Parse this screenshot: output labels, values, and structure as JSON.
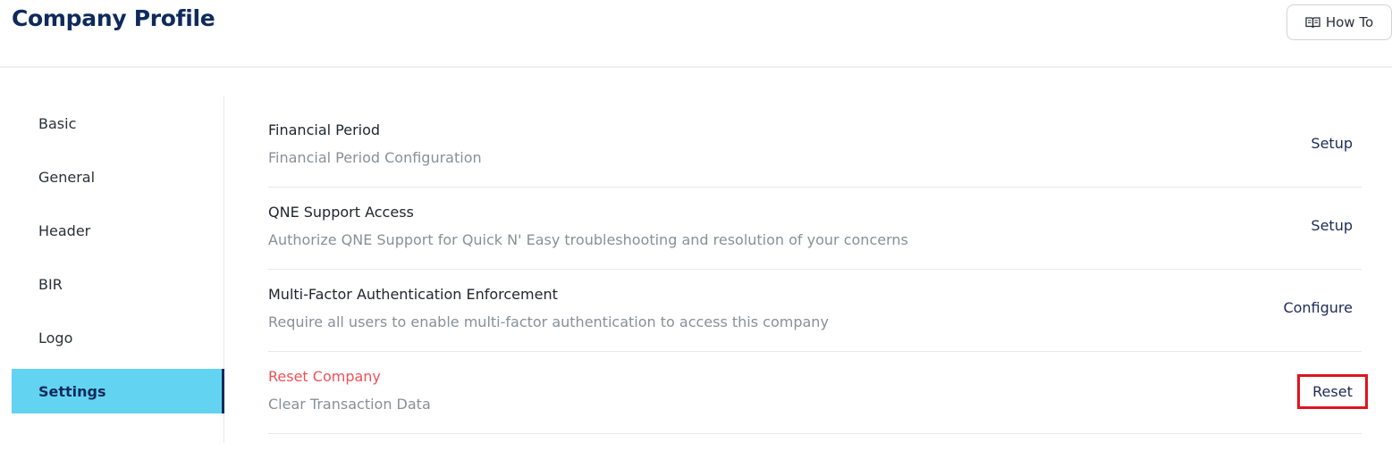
{
  "header": {
    "title": "Company Profile",
    "howto_label": "How To",
    "howto_icon": "book-icon"
  },
  "sidebar": {
    "items": [
      {
        "label": "Basic"
      },
      {
        "label": "General"
      },
      {
        "label": "Header"
      },
      {
        "label": "BIR"
      },
      {
        "label": "Logo"
      },
      {
        "label": "Settings",
        "active": true
      }
    ],
    "active_color": "#62d4f2"
  },
  "settings": {
    "rows": [
      {
        "title": "Financial Period",
        "description": "Financial Period Configuration",
        "action": "Setup"
      },
      {
        "title": "QNE Support Access",
        "description": "Authorize QNE Support for Quick N' Easy troubleshooting and resolution of your concerns",
        "action": "Setup"
      },
      {
        "title": "Multi-Factor Authentication Enforcement",
        "description": "Require all users to enable multi-factor authentication to access this company",
        "action": "Configure"
      },
      {
        "title": "Reset Company",
        "description": "Clear Transaction Data",
        "action": "Reset"
      }
    ],
    "danger_color": "#f0515a",
    "highlight_color": "#e0141e"
  }
}
